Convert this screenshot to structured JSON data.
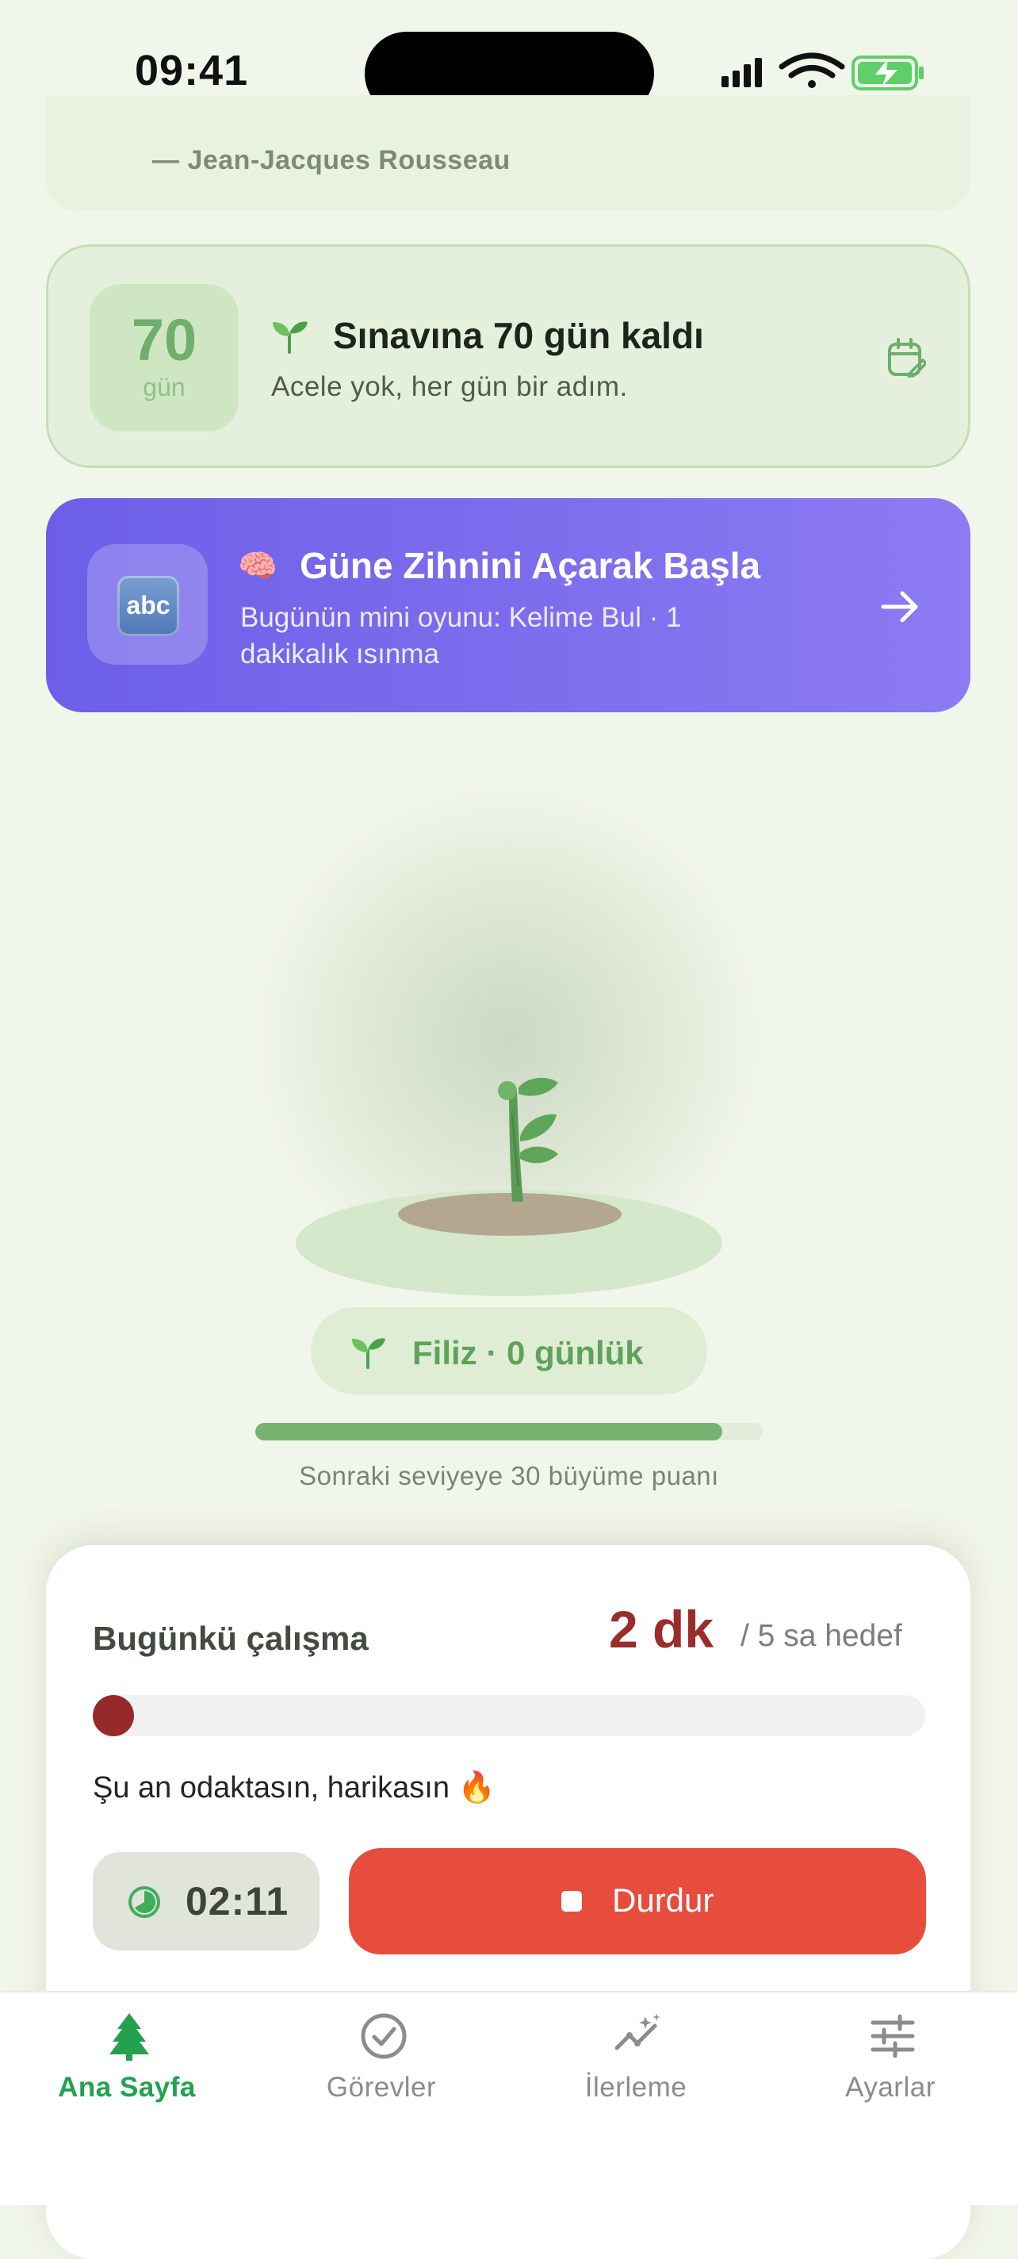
{
  "status": {
    "time": "09:41"
  },
  "quote": {
    "author": "— Jean-Jacques Rousseau"
  },
  "countdown": {
    "days": "70",
    "unit": "gün",
    "title": "Sınavına 70 gün kaldı",
    "subtitle": "Acele yok, her gün bir adım.",
    "icons": [
      "sprout-icon",
      "calendar-edit-icon"
    ]
  },
  "mini_game": {
    "icon_label": "abc",
    "title": "Güne Zihnini Açarak Başla",
    "subtitle": "Bugünün mini oyunu: Kelime Bul · 1 dakikalık ısınma",
    "brain_emoji": "🧠",
    "accent_from": "#6d5ee8",
    "accent_to": "#8c7bf2"
  },
  "plant": {
    "stage_label": "Filiz · 0 günlük",
    "next_level_text": "Sonraki seviyeye 30 büyüme puanı",
    "progress_fraction": 0.92,
    "progress_color": "#78b270"
  },
  "today": {
    "title": "Bugünkü çalışma",
    "value": "2 dk",
    "goal": "/ 5 sa hedef",
    "progress_fraction": 0.007,
    "status": "Şu an odaktasın, harikasın 🔥",
    "timer": "02:11",
    "stop_label": "Durdur",
    "stop_color": "#e74c3c",
    "value_color": "#9b2c2c"
  },
  "tabs": [
    {
      "label": "Ana Sayfa",
      "icon": "tree-icon",
      "active": true
    },
    {
      "label": "Görevler",
      "icon": "check-circle-icon",
      "active": false
    },
    {
      "label": "İlerleme",
      "icon": "progress-sparkle-icon",
      "active": false
    },
    {
      "label": "Ayarlar",
      "icon": "sliders-icon",
      "active": false
    }
  ]
}
